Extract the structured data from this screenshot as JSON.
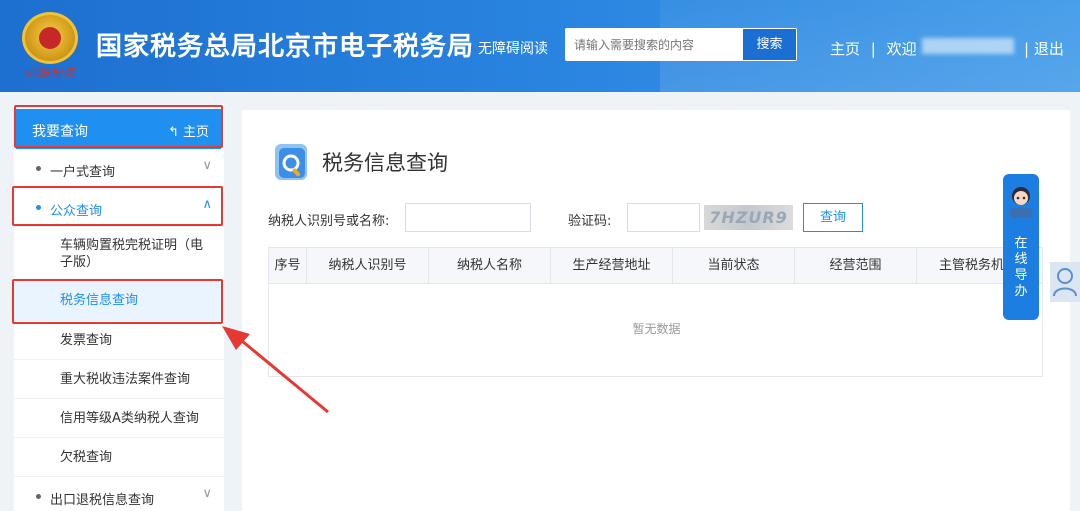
{
  "header": {
    "title": "国家税务总局北京市电子税务局",
    "emblem_script": "中国税务",
    "accessible": "无障碍阅读",
    "search_placeholder": "请输入需要搜索的内容",
    "search_button": "搜索",
    "home": "主页",
    "sep": "|",
    "welcome": "欢迎",
    "logout": "| 退出"
  },
  "sidebar": {
    "head_title": "我要查询",
    "head_home": "主页",
    "items": [
      {
        "label": "一户式查询",
        "chevron": "∨"
      },
      {
        "label": "公众查询",
        "chevron": "∧"
      }
    ],
    "subitems": [
      "车辆购置税完税证明（电子版）",
      "税务信息查询",
      "发票查询",
      "重大税收违法案件查询",
      "信用等级A类纳税人查询",
      "欠税查询"
    ],
    "bottom_item": {
      "label": "出口退税信息查询",
      "chevron": "∨"
    }
  },
  "main": {
    "title": "税务信息查询",
    "taxpayer_label": "纳税人识别号或名称:",
    "captcha_label": "验证码:",
    "captcha_text": "7HZUR9",
    "query_button": "查询",
    "columns": [
      "序号",
      "纳税人识别号",
      "纳税人名称",
      "生产经营地址",
      "当前状态",
      "经营范围",
      "主管税务机关"
    ],
    "empty_text": "暂无数据"
  },
  "float_nav": {
    "text": "在线导办"
  },
  "colors": {
    "header_blue": "#1d6fd0",
    "accent": "#1f8ff0",
    "highlight_red": "#e53935"
  }
}
